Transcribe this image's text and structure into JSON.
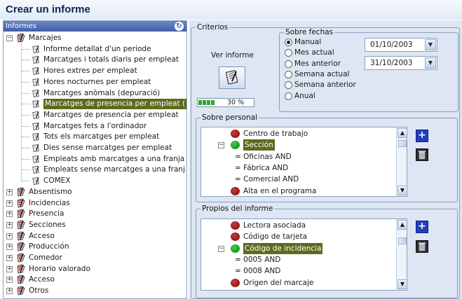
{
  "window": {
    "title": "Crear un informe"
  },
  "left_panel": {
    "header": "Informes",
    "tree": [
      {
        "label": "Marcajes",
        "kind": "folder",
        "expanded": true,
        "children": [
          {
            "label": "Informe detallat d'un periode"
          },
          {
            "label": "Marcatges i totals diaris per empleat"
          },
          {
            "label": "Hores extres per empleat"
          },
          {
            "label": "Hores nocturnes per empleat"
          },
          {
            "label": "Marcatges anòmals (depuració)"
          },
          {
            "label": "Marcatges de presencia per empleat (",
            "selected": true
          },
          {
            "label": "Marcatges de presencia per empleat"
          },
          {
            "label": "Marcatges fets a l'ordinador"
          },
          {
            "label": "Tots els marcatges per empleat"
          },
          {
            "label": "Dies sense marcatges per empleat"
          },
          {
            "label": "Empleats amb marcatges a una franja"
          },
          {
            "label": "Empleats sense marcatges a una franj"
          },
          {
            "label": "COMEX"
          }
        ]
      },
      {
        "label": "Absentismo",
        "kind": "folder"
      },
      {
        "label": "Incidencias",
        "kind": "folder"
      },
      {
        "label": "Presencia",
        "kind": "folder"
      },
      {
        "label": "Secciones",
        "kind": "folder"
      },
      {
        "label": "Acceso",
        "kind": "folder"
      },
      {
        "label": "Producción",
        "kind": "folder"
      },
      {
        "label": "Comedor",
        "kind": "folder"
      },
      {
        "label": "Horario valorado",
        "kind": "folder"
      },
      {
        "label": "Acceso",
        "kind": "folder"
      },
      {
        "label": "Otros",
        "kind": "folder"
      }
    ]
  },
  "criterios": {
    "legend": "Criterios",
    "view_report_label": "Ver informe",
    "progress": {
      "percent": 30,
      "text": "30 %"
    },
    "dates": {
      "legend": "Sobre fechas",
      "options": [
        {
          "label": "Manual",
          "checked": true
        },
        {
          "label": "Mes actual"
        },
        {
          "label": "Mes anterior"
        },
        {
          "label": "Semana actual"
        },
        {
          "label": "Semana anterior"
        },
        {
          "label": "Anual"
        }
      ],
      "from": "01/10/2003",
      "to": "31/10/2003"
    },
    "personal": {
      "legend": "Sobre personal",
      "items": [
        {
          "label": "Centro de trabajo",
          "marker": "red"
        },
        {
          "label": "Sección",
          "marker": "green",
          "selected": true,
          "expanded": true
        },
        {
          "label": "= Oficinas AND",
          "marker": "none"
        },
        {
          "label": "= Fábrica AND",
          "marker": "none"
        },
        {
          "label": "= Comercial AND",
          "marker": "none"
        },
        {
          "label": "Alta en el programa",
          "marker": "red"
        }
      ]
    },
    "propios": {
      "legend": "Propios del informe",
      "items": [
        {
          "label": "Lectora asociada",
          "marker": "red"
        },
        {
          "label": "Código de tarjeta",
          "marker": "red"
        },
        {
          "label": "Código de incidencia",
          "marker": "green",
          "selected": true,
          "expanded": true
        },
        {
          "label": "= 0005 AND",
          "marker": "none"
        },
        {
          "label": "= 0008 AND",
          "marker": "none"
        },
        {
          "label": "Origen del marcaje",
          "marker": "red"
        }
      ]
    },
    "colors": {
      "marker_red": "#8b0f0f",
      "marker_green": "#139a1a",
      "selection": "#5e6b1f",
      "add_button": "#1f3fbf"
    }
  }
}
